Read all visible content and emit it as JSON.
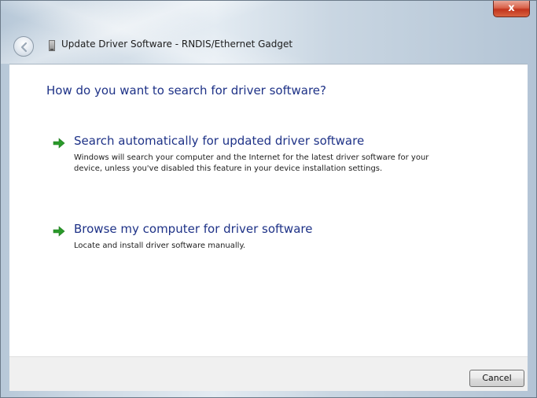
{
  "window": {
    "title": "Update Driver Software - RNDIS/Ethernet Gadget",
    "close_label": "x"
  },
  "main": {
    "question": "How do you want to search for driver software?",
    "options": [
      {
        "title": "Search automatically for updated driver software",
        "description": "Windows will search your computer and the Internet for the latest driver software for your device, unless you've disabled this feature in your device installation settings.",
        "icon": "green-arrow-icon"
      },
      {
        "title": "Browse my computer for driver software",
        "description": "Locate and install driver software manually.",
        "icon": "green-arrow-icon"
      }
    ]
  },
  "footer": {
    "cancel_label": "Cancel"
  },
  "colors": {
    "accent": "#1e3287",
    "arrow": "#2a9a2a",
    "close_button": "#c7452e"
  }
}
